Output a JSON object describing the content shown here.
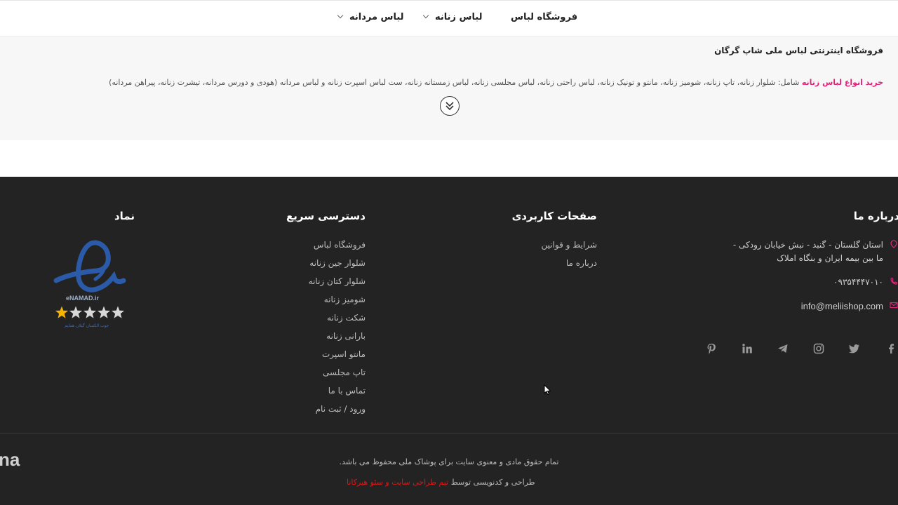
{
  "nav": {
    "items": [
      {
        "label": "فروشگاه لباس",
        "has_dropdown": false
      },
      {
        "label": "لباس زنانه",
        "has_dropdown": true
      },
      {
        "label": "لباس مردانه",
        "has_dropdown": true
      }
    ]
  },
  "description": {
    "title": "فروشگاه اینترنتی لباس ملی شاپ گرگان",
    "highlight": "خرید انواع لباس زنانه",
    "text": " شامل: شلوار زنانه، تاپ زنانه، شومیز زنانه، مانتو و تونیک زنانه، لباس راحتی زنانه، لباس مجلسی زنانه، لباس زمستانه زنانه، ست لباس اسپرت زنانه و لباس مردانه (هودی و دورس مردانه، تیشرت زنانه، پیراهن مردانه)",
    "expand_icon": "double-chevron-down-icon"
  },
  "footer": {
    "about": {
      "title": "درباره ما",
      "address_line1": "استان گلستان - گنبد - نبش خیابان رودکی -",
      "address_line2": "ما بین بیمه ایران و بنگاه املاک",
      "phone": "۰۹۳۵۴۴۴۷۰۱۰",
      "email": "info@meliishop.com",
      "accent_color": "#e0247a"
    },
    "useful_pages": {
      "title": "صفحات کاربردی",
      "links": [
        "شرایط و قوانین",
        "درباره ما"
      ]
    },
    "quick_access": {
      "title": "دسترسی سریع",
      "links": [
        "فروشگاه لباس",
        "شلوار جین زنانه",
        "شلوار کتان زنانه",
        "شومیز زنانه",
        "شکت زنانه",
        "بارانی زنانه",
        "مانتو اسپرت",
        "تاپ مجلسی",
        "تماس با ما",
        "ورود / ثبت نام"
      ]
    },
    "namad": {
      "title": "نماد",
      "badge_text": "eNAMAD.ir",
      "badge_subtext": "جوب الکسان گیلان همایم",
      "stars_filled": 1,
      "stars_total": 5
    },
    "social_icons": [
      "facebook-icon",
      "twitter-icon",
      "instagram-icon",
      "telegram-icon",
      "linkedin-icon",
      "pinterest-icon"
    ],
    "copyright": "تمام حقوق مادی و معنوی سایت برای پوشاک ملی محفوظ می باشد.",
    "design_prefix": "طراحی و کدنویسی توسط",
    "design_link": "تیم طراحی سایت و سئو هیرکانا",
    "brand_partial": "na"
  }
}
